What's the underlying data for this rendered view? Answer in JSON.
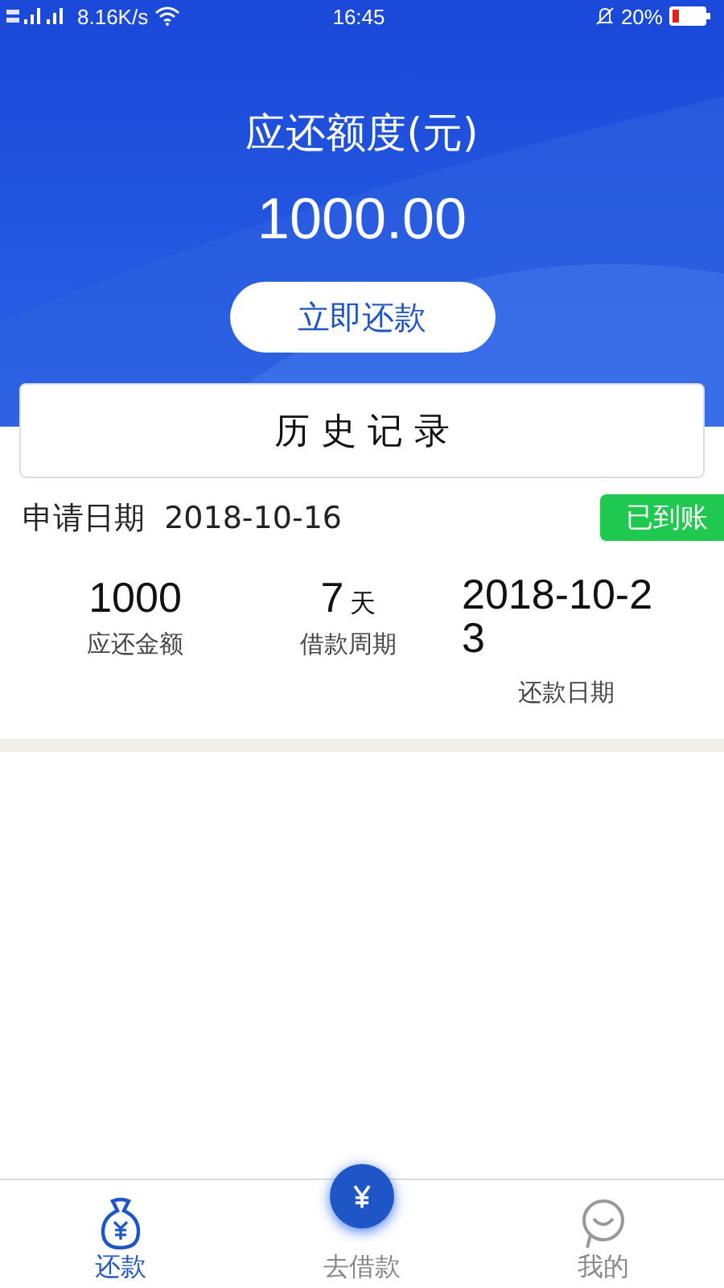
{
  "status_bar": {
    "speed": "8.16K/s",
    "time": "16:45",
    "battery": "20%"
  },
  "header": {
    "title": "应还额度(元)",
    "amount": "1000.00",
    "button": "立即还款"
  },
  "history": {
    "title": "历 史 记 录"
  },
  "records": [
    {
      "date_label": "申请日期",
      "date": "2018-10-16",
      "status": "已到账",
      "color": "#1fc94f",
      "stats": [
        {
          "value": "1000",
          "label": "应还金额"
        },
        {
          "value": "7",
          "unit": "天",
          "label": "借款周期"
        },
        {
          "value": "2018-10-23",
          "label": "还款日期"
        }
      ]
    }
  ],
  "tabbar": [
    {
      "label": "还款",
      "kind": "bag",
      "selected": true
    },
    {
      "label": "去借款",
      "kind": "center",
      "selected": false
    },
    {
      "label": "我的",
      "kind": "person",
      "selected": false
    }
  ]
}
